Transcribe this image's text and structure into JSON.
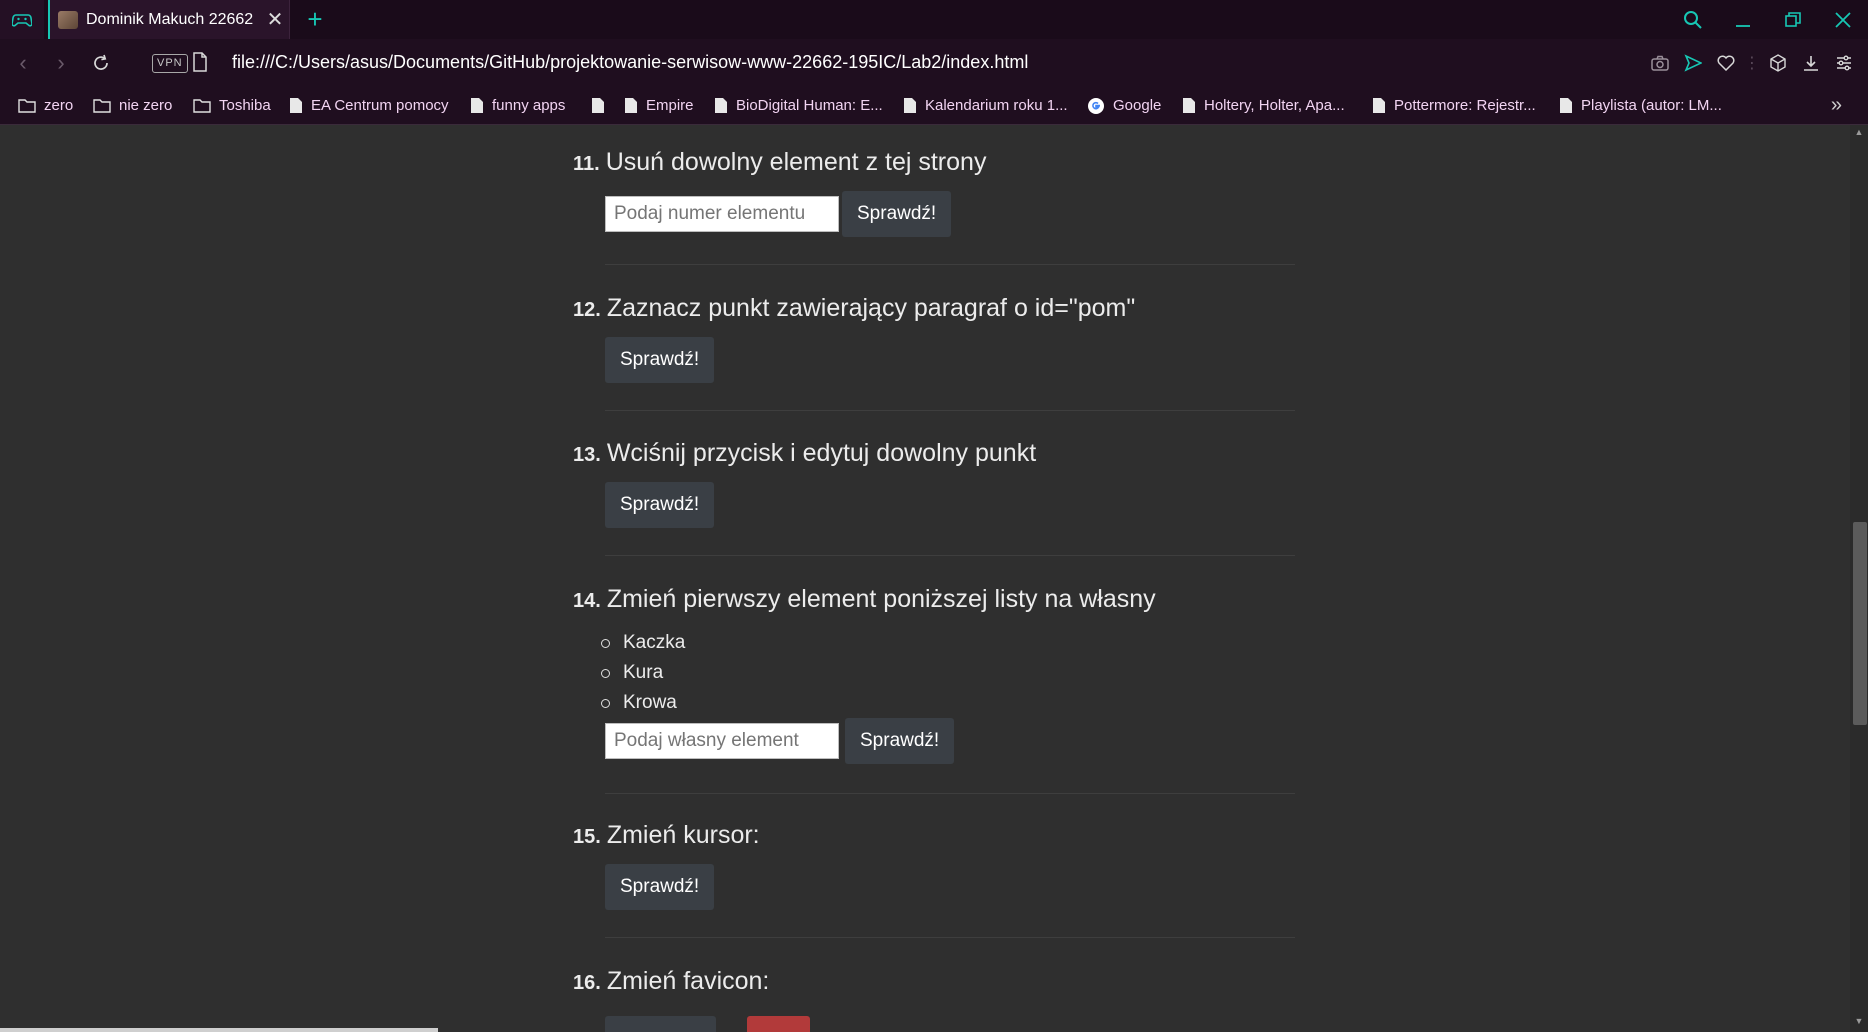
{
  "browser": {
    "tab_title": "Dominik Makuch 22662",
    "url": "file:///C:/Users/asus/Documents/GitHub/projektowanie-serwisow-www-22662-195IC/Lab2/index.html",
    "vpn_label": "VPN",
    "accent_color": "#17c7b4",
    "bookmarks": [
      {
        "label": "zero",
        "icon": "folder-icon"
      },
      {
        "label": "nie zero",
        "icon": "folder-icon"
      },
      {
        "label": "Toshiba",
        "icon": "folder-icon"
      },
      {
        "label": "EA Centrum pomocy",
        "icon": "page-icon"
      },
      {
        "label": "funny apps",
        "icon": "page-icon"
      },
      {
        "label": "",
        "icon": "page-icon"
      },
      {
        "label": "Empire",
        "icon": "page-icon"
      },
      {
        "label": "BioDigital Human: E...",
        "icon": "page-icon"
      },
      {
        "label": "Kalendarium roku 1...",
        "icon": "page-icon"
      },
      {
        "label": "Google",
        "icon": "google-icon"
      },
      {
        "label": "Holtery, Holter, Apa...",
        "icon": "page-icon"
      },
      {
        "label": "Pottermore: Rejestr...",
        "icon": "page-icon"
      },
      {
        "label": "Playlista (autor: LM...",
        "icon": "page-icon"
      }
    ]
  },
  "tasks": [
    {
      "number": "11.",
      "title": "Usuń dowolny element z tej strony",
      "input_placeholder": "Podaj numer elementu",
      "button": "Sprawdź!"
    },
    {
      "number": "12.",
      "title": "Zaznacz punkt zawierający paragraf o id=\"pom\"",
      "button": "Sprawdź!"
    },
    {
      "number": "13.",
      "title": "Wciśnij przycisk i edytuj dowolny punkt",
      "button": "Sprawdź!"
    },
    {
      "number": "14.",
      "title": "Zmień pierwszy element poniższej listy na własny",
      "list": [
        "Kaczka",
        "Kura",
        "Krowa"
      ],
      "input_placeholder": "Podaj własny element",
      "button": "Sprawdź!"
    },
    {
      "number": "15.",
      "title": "Zmień kursor:",
      "button": "Sprawdź!"
    },
    {
      "number": "16.",
      "title": "Zmień favicon:"
    }
  ]
}
